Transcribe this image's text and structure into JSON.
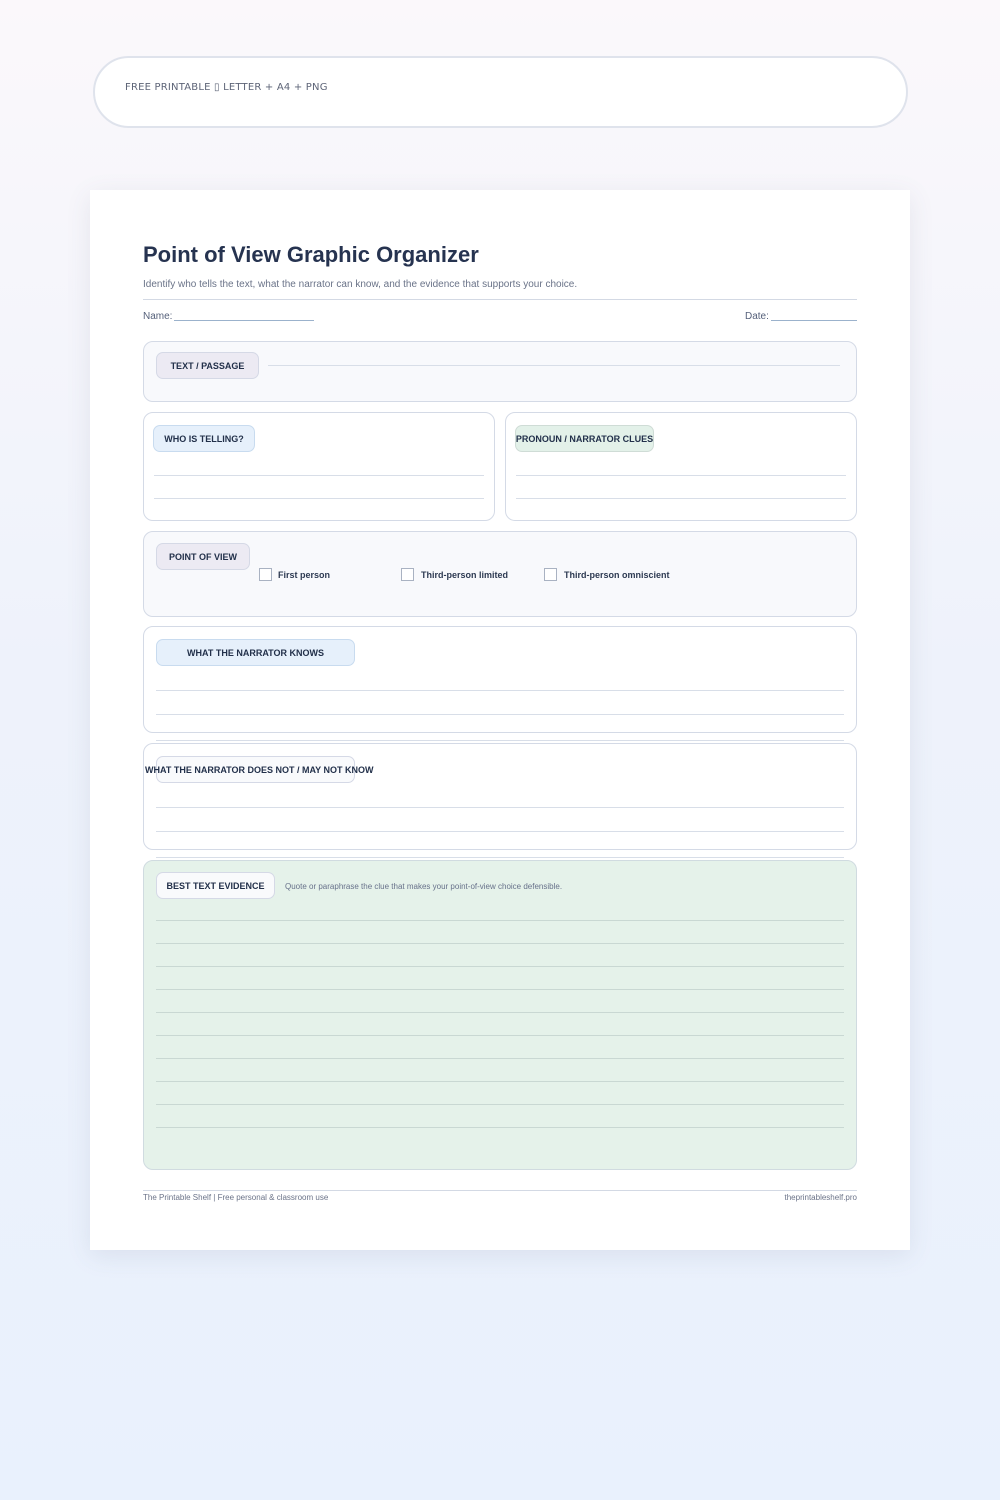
{
  "banner": {
    "text": "FREE PRINTABLE ▯ LETTER + A4 + PNG"
  },
  "worksheet": {
    "title": "Point of View Graphic Organizer",
    "subtitle": "Identify who tells the text, what the narrator can know, and the evidence that supports your choice.",
    "name_label": "Name:",
    "date_label": "Date:"
  },
  "sections": {
    "text_passage": "TEXT / PASSAGE",
    "who_is_telling": "WHO IS TELLING?",
    "pronoun_clues": "PRONOUN / NARRATOR CLUES",
    "point_of_view": {
      "label": "POINT OF VIEW",
      "options": [
        "First person",
        "Third-person limited",
        "Third-person omniscient"
      ]
    },
    "narrator_knows": "WHAT THE NARRATOR KNOWS",
    "narrator_not_know": "WHAT THE NARRATOR DOES NOT / MAY NOT KNOW",
    "best_evidence": {
      "label": "BEST TEXT EVIDENCE",
      "hint": "Quote or paraphrase the clue that makes your point-of-view choice defensible."
    }
  },
  "footer": {
    "left": "The Printable Shelf  |  Free personal & classroom use",
    "right": "theprintableshelf.pro"
  }
}
